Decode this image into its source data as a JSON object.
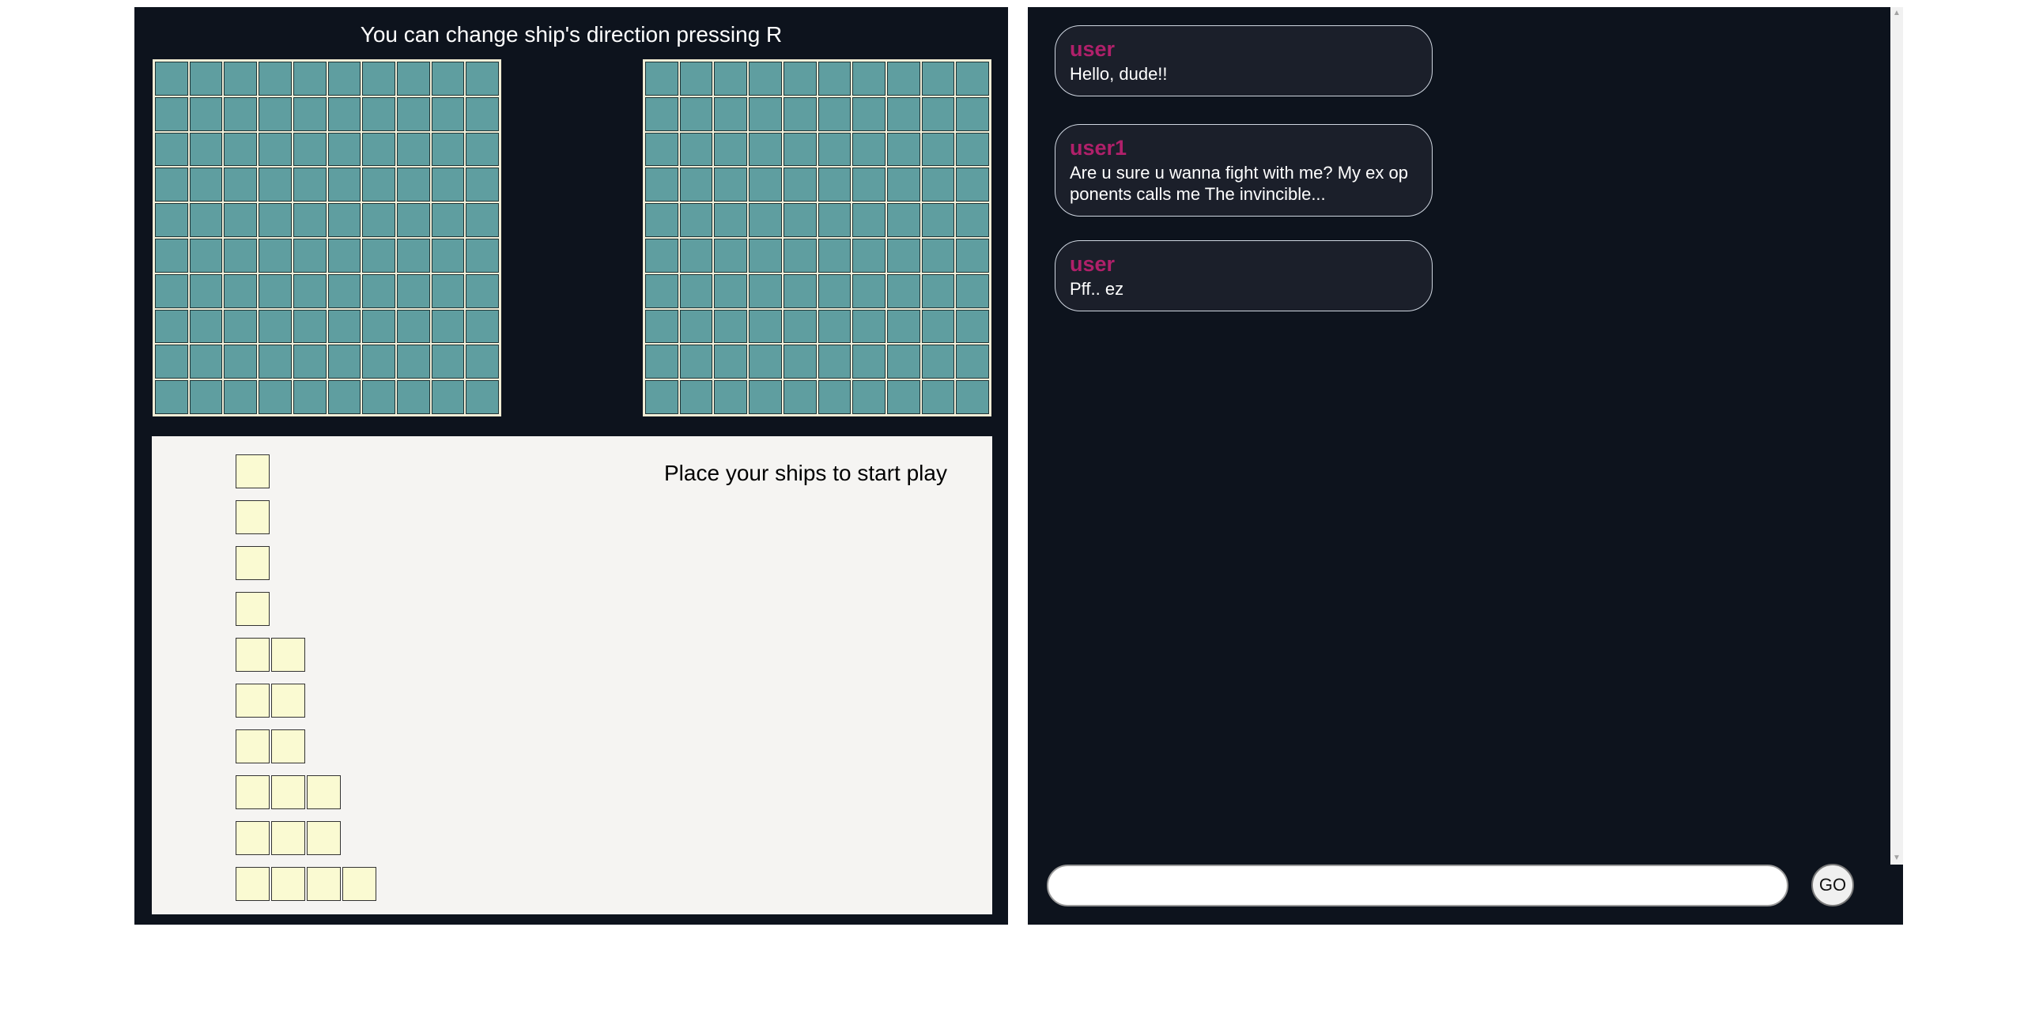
{
  "game": {
    "hint": "You can change ship's direction pressing R",
    "grid_size": 10,
    "dock_message": "Place your ships to start play",
    "ship_lengths": [
      1,
      1,
      1,
      1,
      2,
      2,
      2,
      3,
      3,
      4
    ]
  },
  "chat": {
    "messages": [
      {
        "user": "user",
        "text": "Hello, dude!!"
      },
      {
        "user": "user1",
        "text": "Are u sure u wanna fight with me? My ex op ponents calls me The invincible..."
      },
      {
        "user": "user",
        "text": "Pff.. ez"
      }
    ],
    "input": {
      "value": "",
      "placeholder": ""
    },
    "send_label": "GO"
  },
  "colors": {
    "panel_bg": "#0d131d",
    "cell": "#5f9ea0",
    "ship": "#fafad2",
    "username": "#b0206a",
    "message_bg": "#1b1f2a"
  }
}
